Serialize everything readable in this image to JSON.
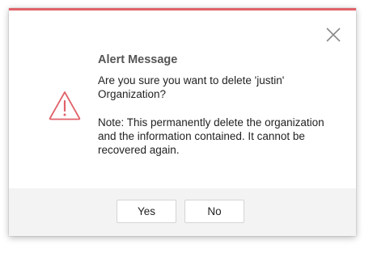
{
  "dialog": {
    "title": "Alert Message",
    "message": "Are you sure you want to delete 'justin' Organization?",
    "note": "Note: This permanently delete the organization and the information contained. It cannot be recovered again.",
    "icons": {
      "close": "close-icon",
      "warning": "warning-triangle-icon"
    },
    "colors": {
      "accent": "#e0626a",
      "warning": "#e0626a",
      "footer_bg": "#f3f3f3"
    }
  },
  "footer": {
    "yes_label": "Yes",
    "no_label": "No"
  }
}
